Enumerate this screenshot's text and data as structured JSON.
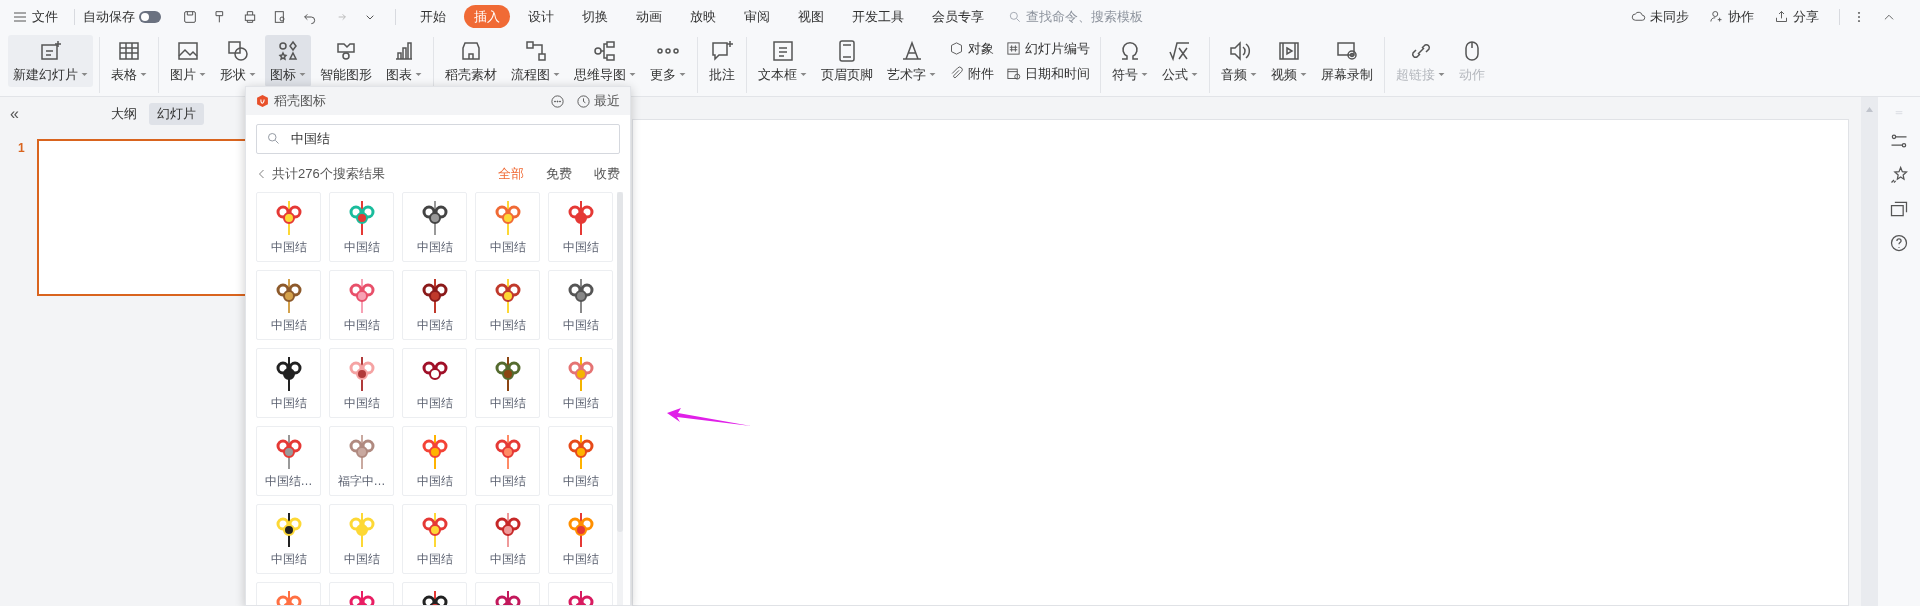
{
  "menu_bar": {
    "file_label": "文件",
    "autosave": {
      "label": "自动保存",
      "on": false
    },
    "tabs": [
      {
        "label": "开始",
        "selected": false
      },
      {
        "label": "插入",
        "selected": true
      },
      {
        "label": "设计",
        "selected": false
      },
      {
        "label": "切换",
        "selected": false
      },
      {
        "label": "动画",
        "selected": false
      },
      {
        "label": "放映",
        "selected": false
      },
      {
        "label": "审阅",
        "selected": false
      },
      {
        "label": "视图",
        "selected": false
      },
      {
        "label": "开发工具",
        "selected": false
      },
      {
        "label": "会员专享",
        "selected": false
      }
    ],
    "search": {
      "placeholder": "查找命令、搜索模板"
    },
    "actions": [
      "未同步",
      "协作",
      "分享"
    ]
  },
  "ribbon_groups": [
    [
      {
        "kind": "split",
        "label": "新建幻灯片",
        "dropdown": true,
        "expanded": false,
        "disabled": false
      }
    ],
    [
      {
        "kind": "large",
        "label": "表格",
        "dropdown": true,
        "expanded": false,
        "disabled": false
      }
    ],
    [
      {
        "kind": "large",
        "label": "图片",
        "dropdown": true,
        "expanded": false,
        "disabled": false
      },
      {
        "kind": "large",
        "label": "形状",
        "dropdown": true,
        "expanded": false,
        "disabled": false
      },
      {
        "kind": "large",
        "label": "图标",
        "dropdown": true,
        "expanded": true,
        "disabled": false
      },
      {
        "kind": "large",
        "label": "智能图形",
        "dropdown": false,
        "expanded": false,
        "disabled": false
      },
      {
        "kind": "large",
        "label": "图表",
        "dropdown": true,
        "expanded": false,
        "disabled": false
      }
    ],
    [
      {
        "kind": "large",
        "label": "稻壳素材",
        "dropdown": false,
        "expanded": false,
        "disabled": false
      },
      {
        "kind": "large",
        "label": "流程图",
        "dropdown": true,
        "expanded": false,
        "disabled": false
      },
      {
        "kind": "large",
        "label": "思维导图",
        "dropdown": true,
        "expanded": false,
        "disabled": false
      },
      {
        "kind": "large",
        "label": "更多",
        "dropdown": true,
        "expanded": false,
        "disabled": false
      }
    ],
    [
      {
        "kind": "large",
        "label": "批注",
        "dropdown": false,
        "expanded": false,
        "disabled": false
      }
    ],
    [
      {
        "kind": "large",
        "label": "文本框",
        "dropdown": true,
        "expanded": false,
        "disabled": false
      },
      {
        "kind": "large",
        "label": "页眉页脚",
        "dropdown": false,
        "expanded": false,
        "disabled": false
      },
      {
        "kind": "large",
        "label": "艺术字",
        "dropdown": true,
        "expanded": false,
        "disabled": false
      },
      {
        "kind": "stack",
        "items": [
          "对象",
          "附件"
        ]
      },
      {
        "kind": "stack",
        "items": [
          "幻灯片编号",
          "日期和时间"
        ]
      }
    ],
    [
      {
        "kind": "large",
        "label": "符号",
        "dropdown": true,
        "expanded": false,
        "disabled": false
      },
      {
        "kind": "large",
        "label": "公式",
        "dropdown": true,
        "expanded": false,
        "disabled": false
      }
    ],
    [
      {
        "kind": "large",
        "label": "音频",
        "dropdown": true,
        "expanded": false,
        "disabled": false
      },
      {
        "kind": "large",
        "label": "视频",
        "dropdown": true,
        "expanded": false,
        "disabled": false
      },
      {
        "kind": "large",
        "label": "屏幕录制",
        "dropdown": false,
        "expanded": false,
        "disabled": false
      }
    ],
    [
      {
        "kind": "large",
        "label": "超链接",
        "dropdown": true,
        "expanded": false,
        "disabled": true
      },
      {
        "kind": "large",
        "label": "动作",
        "dropdown": false,
        "expanded": false,
        "disabled": true
      }
    ]
  ],
  "left_pane": {
    "collapse": "«",
    "tabs": [
      {
        "label": "大纲",
        "selected": false
      },
      {
        "label": "幻灯片",
        "selected": true
      }
    ],
    "slides": [
      {
        "number": "1",
        "selected": true
      }
    ]
  },
  "icon_panel": {
    "title": "稻壳图标",
    "recent": "最近",
    "search_value": "中国结",
    "result_count": "共计276个搜索结果",
    "filters": [
      {
        "label": "全部",
        "selected": true
      },
      {
        "label": "免费",
        "selected": false
      },
      {
        "label": "收费",
        "selected": false
      }
    ],
    "icons": [
      {
        "label": "中国结"
      },
      {
        "label": "中国结"
      },
      {
        "label": "中国结"
      },
      {
        "label": "中国结"
      },
      {
        "label": "中国结"
      },
      {
        "label": "中国结"
      },
      {
        "label": "中国结"
      },
      {
        "label": "中国结"
      },
      {
        "label": "中国结"
      },
      {
        "label": "中国结"
      },
      {
        "label": "中国结"
      },
      {
        "label": "中国结"
      },
      {
        "label": "中国结"
      },
      {
        "label": "中国结"
      },
      {
        "label": "中国结"
      },
      {
        "label": "中国结…"
      },
      {
        "label": "福字中…"
      },
      {
        "label": "中国结"
      },
      {
        "label": "中国结"
      },
      {
        "label": "中国结"
      },
      {
        "label": "中国结"
      },
      {
        "label": "中国结"
      },
      {
        "label": "中国结"
      },
      {
        "label": "中国结"
      },
      {
        "label": "中国结"
      }
    ]
  }
}
